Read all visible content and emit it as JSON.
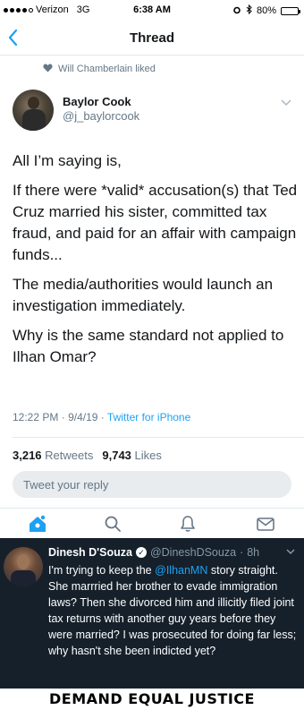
{
  "status_bar": {
    "carrier": "Verizon",
    "network": "3G",
    "time": "6:38 AM",
    "battery_percent": "80%",
    "battery_level": 0.8,
    "signal_bars": 4
  },
  "nav": {
    "title": "Thread",
    "back_icon": "chevron-left-icon"
  },
  "social_context": {
    "text": "Will Chamberlain liked",
    "icon": "heart-icon"
  },
  "tweet": {
    "author_name": "Baylor Cook",
    "author_handle": "@j_baylorcook",
    "paragraphs": [
      "All I’m saying is,",
      "If there were *valid* accusation(s) that Ted Cruz married his sister, committed tax fraud, and paid for an affair with campaign funds...",
      "The media/authorities would launch an investigation immediately.",
      "Why is the same standard not applied to Ilhan Omar?"
    ],
    "time": "12:22 PM",
    "date": "9/4/19",
    "source": "Twitter for iPhone",
    "retweets_count": "3,216",
    "retweets_label": "Retweets",
    "likes_count": "9,743",
    "likes_label": "Likes"
  },
  "reply": {
    "placeholder": "Tweet your reply"
  },
  "tabbar": {
    "items": [
      "home-icon",
      "search-icon",
      "bell-icon",
      "mail-icon"
    ],
    "accent": "#1da1f2"
  },
  "embedded_tweet": {
    "author_name": "Dinesh D'Souza",
    "author_handle": "@DineshDSouza",
    "time": "8h",
    "text_before": "I'm trying to keep the ",
    "mention": "@IlhanMN",
    "text_after": " story straight. She marrried her brother to evade immigration laws? Then she divorced him and illicitly filed joint tax returns with another guy years before they were married? I was prosecuted for doing far less; why hasn't she been indicted yet?",
    "background": "#15202b"
  },
  "banner": {
    "text": "DEMAND EQUAL JUSTICE"
  },
  "colors": {
    "accent": "#1da1f2",
    "muted": "#657786",
    "text": "#14171a"
  }
}
